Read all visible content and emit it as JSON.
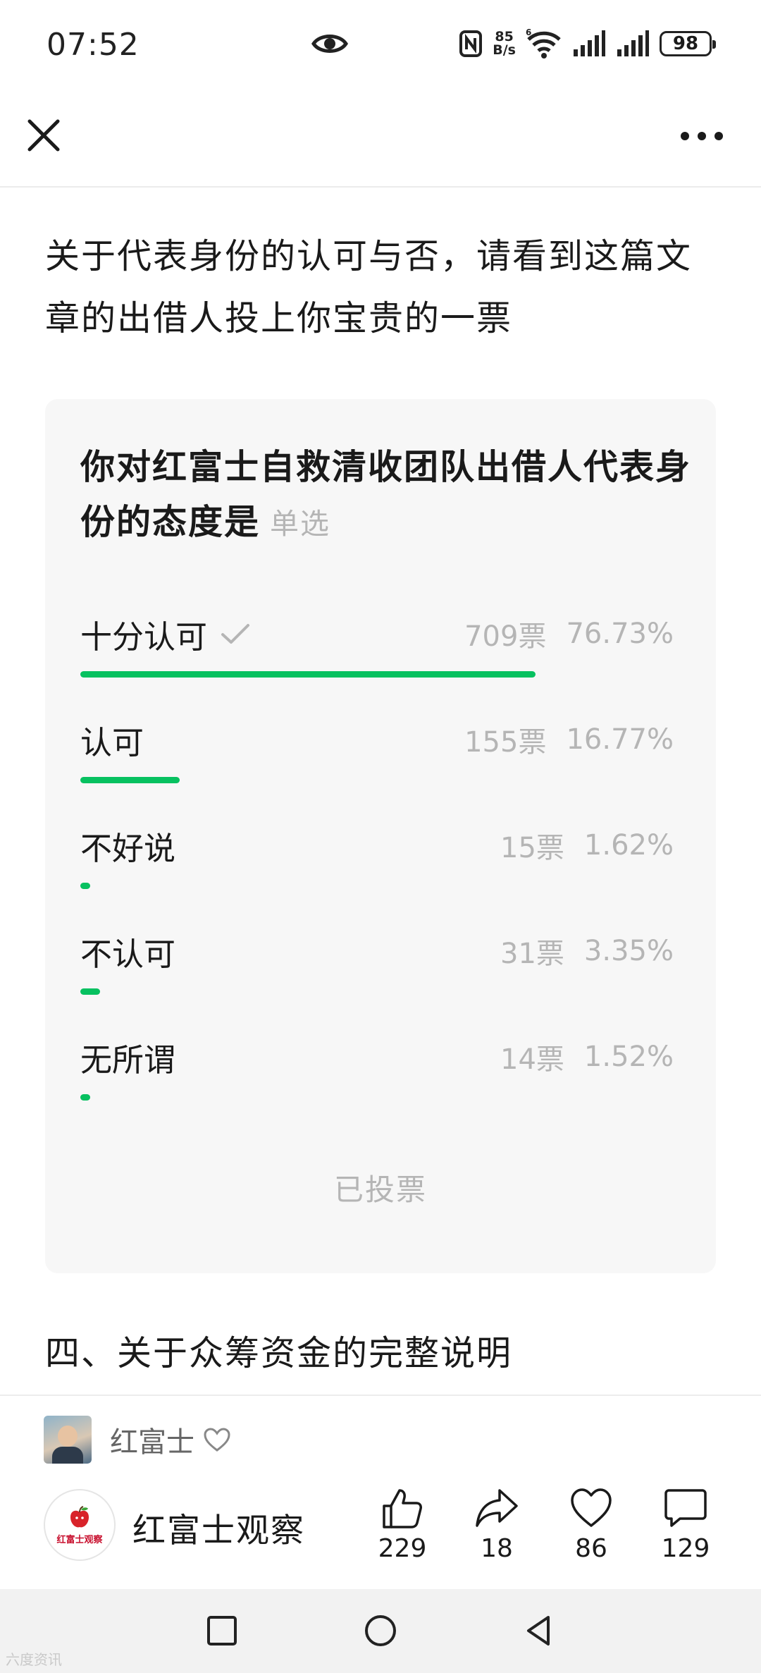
{
  "status_bar": {
    "time": "07:52",
    "net_speed_value": "85",
    "net_speed_unit": "B/s",
    "battery": "98",
    "icons": [
      "eye-icon",
      "nfc-icon",
      "wifi-icon",
      "signal-icon",
      "signal-icon",
      "battery-icon"
    ]
  },
  "nav": {
    "close_icon": "close-icon",
    "more_icon": "more-icon"
  },
  "article": {
    "intro": "关于代表身份的认可与否，请看到这篇文章的出借人投上你宝贵的一票",
    "section_heading": "四、关于众筹资金的完整说明"
  },
  "poll": {
    "question": "你对红富士自救清收团队出借人代表身份的态度是",
    "type_label": "单选",
    "status": "已投票",
    "accent_color": "#07c160",
    "options": [
      {
        "label": "十分认可",
        "votes": "709票",
        "percent": "76.73%",
        "selected": true,
        "fraction": 0.7673
      },
      {
        "label": "认可",
        "votes": "155票",
        "percent": "16.77%",
        "selected": false,
        "fraction": 0.1677
      },
      {
        "label": "不好说",
        "votes": "15票",
        "percent": "1.62%",
        "selected": false,
        "fraction": 0.0162
      },
      {
        "label": "不认可",
        "votes": "31票",
        "percent": "3.35%",
        "selected": false,
        "fraction": 0.0335
      },
      {
        "label": "无所谓",
        "votes": "14票",
        "percent": "1.52%",
        "selected": false,
        "fraction": 0.0152
      }
    ]
  },
  "author": {
    "name": "红富士"
  },
  "account": {
    "name": "红富士观察",
    "logo_text": "红富士观察"
  },
  "actions": {
    "like": "229",
    "share": "18",
    "favorite": "86",
    "comment": "129"
  },
  "watermark": "六度资讯"
}
